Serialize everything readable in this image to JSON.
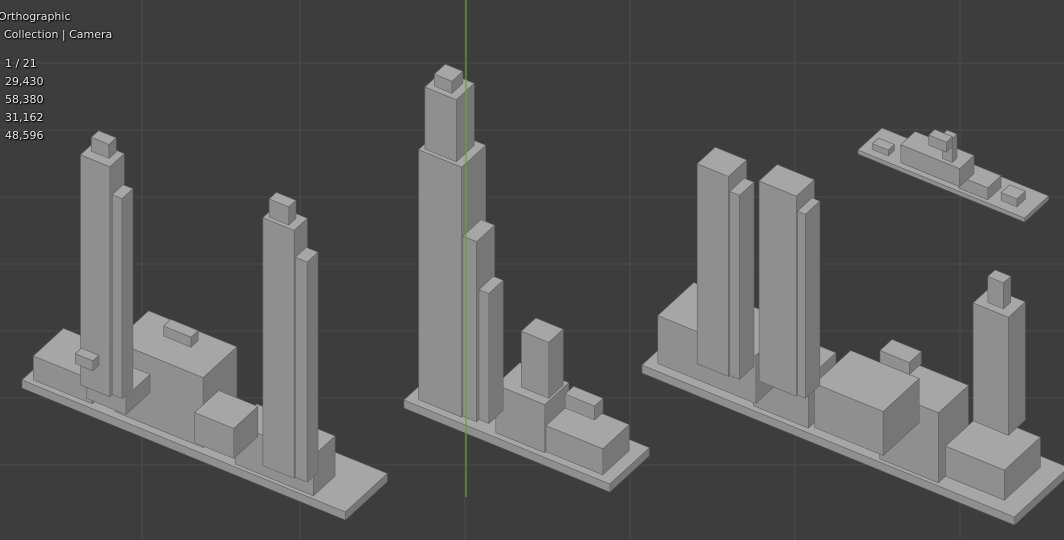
{
  "viewport": {
    "view_name": "Orthographic",
    "collection_label": "Collection | Camera",
    "stats": [
      "1 / 21",
      "29,430",
      "58,380",
      "31,162",
      "48,596"
    ],
    "colors": {
      "background": "#3d3d3d",
      "grid_line": "#4b4b4b",
      "axis_green": "#6e9e2c",
      "building_top": "#a6a6a6",
      "building_left": "#8f8f8f",
      "building_right": "#767676",
      "base_dark": "#5a5a5a"
    },
    "objects": [
      {
        "name": "twin-tower-block-left",
        "type": "mesh"
      },
      {
        "name": "single-tower-block-middle",
        "type": "mesh"
      },
      {
        "name": "twin-tower-block-right",
        "type": "mesh"
      },
      {
        "name": "small-block-top-right",
        "type": "mesh"
      }
    ]
  }
}
